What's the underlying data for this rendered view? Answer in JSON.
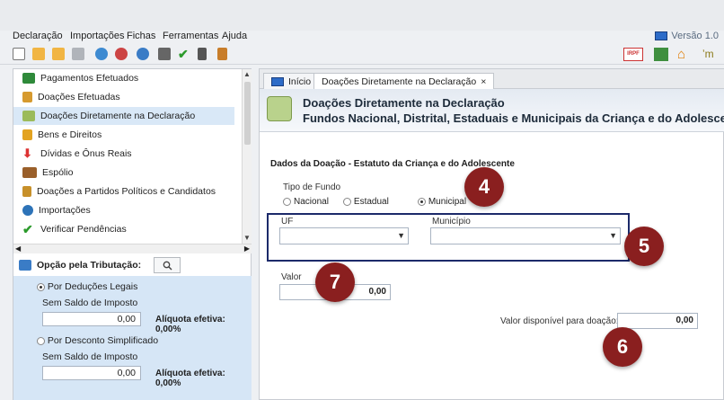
{
  "menu": [
    "Declaração",
    "Importações",
    "Fichas",
    "Ferramentas",
    "Ajuda"
  ],
  "version_label": "Versão 1.0",
  "toolbar_right": {
    "irpf_badge": "IRPF"
  },
  "nav": {
    "items": [
      {
        "label": "Pagamentos Efetuados",
        "icon": "payments-icon"
      },
      {
        "label": "Doações Efetuadas",
        "icon": "donation-icon"
      },
      {
        "label": "Doações Diretamente na Declaração",
        "icon": "children-icon",
        "selected": true
      },
      {
        "label": "Bens e Direitos",
        "icon": "assets-icon"
      },
      {
        "label": "Dívidas e Ônus Reais",
        "icon": "debt-icon"
      },
      {
        "label": "Espólio",
        "icon": "estate-icon"
      },
      {
        "label": "Doações a Partidos Políticos e Candidatos",
        "icon": "party-icon"
      },
      {
        "label": "Importações",
        "icon": "import-icon"
      },
      {
        "label": "Verificar Pendências",
        "icon": "check-icon"
      }
    ]
  },
  "tributacao": {
    "title": "Opção pela Tributação:",
    "deducoes_label": "Por Deduções Legais",
    "saldo1_label": "Sem Saldo de Imposto",
    "saldo1_value": "0,00",
    "aliquota1": "Alíquota efetiva: 0,00%",
    "desconto_label": "Por Desconto Simplificado",
    "saldo2_label": "Sem Saldo de Imposto",
    "saldo2_value": "0,00",
    "aliquota2": "Alíquota efetiva: 0,00%"
  },
  "tabs": [
    {
      "label": "Início"
    },
    {
      "label": "Doações Diretamente na Declaração",
      "close": "×"
    }
  ],
  "header": {
    "line1": "Doações Diretamente na Declaração",
    "line2": "Fundos Nacional, Distrital, Estaduais e Municipais da Criança e do Adolescente"
  },
  "form": {
    "section_title": "Dados da Doação - Estatuto da Criança e do Adolescente",
    "tipo_label": "Tipo de Fundo",
    "options": [
      "Nacional",
      "Estadual",
      "Municipal"
    ],
    "selected_option": "Municipal",
    "uf_label": "UF",
    "municipio_label": "Município",
    "valor_label": "Valor",
    "valor_value": "0,00",
    "disponivel_label": "Valor disponível para doação:",
    "disponivel_value": "0,00"
  },
  "callouts": [
    "4",
    "5",
    "6",
    "7"
  ],
  "colors": {
    "callout": "#8a1f1f",
    "highlight_box": "#1c2a6a",
    "panel_blue": "#d6e6f6"
  }
}
